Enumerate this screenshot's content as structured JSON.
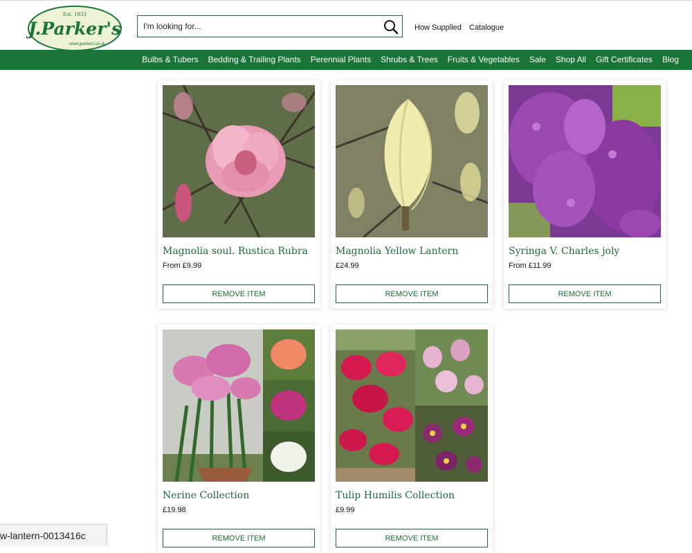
{
  "brand": {
    "logo_text": "J.Parker's",
    "logo_est": "Est. 1933",
    "logo_url": "www.jparkers.co.uk",
    "accent_color": "#1a7437"
  },
  "search": {
    "placeholder": "I'm looking for...",
    "value": ""
  },
  "header_links": [
    "How Supplied",
    "Catalogue"
  ],
  "nav_items": [
    "Bulbs & Tubers",
    "Bedding & Trailing Plants",
    "Perennial Plants",
    "Shrubs & Trees",
    "Fruits & Vegetables",
    "Sale",
    "Shop All",
    "Gift Certificates",
    "Blog"
  ],
  "products": [
    {
      "name": "Magnolia soul. Rustica Rubra",
      "price": "From £9.99",
      "button": "REMOVE ITEM"
    },
    {
      "name": "Magnolia Yellow Lantern",
      "price": "£24.99",
      "button": "REMOVE ITEM"
    },
    {
      "name": "Syringa V. Charles joly",
      "price": "From £11.99",
      "button": "REMOVE ITEM"
    },
    {
      "name": "Nerine Collection",
      "price": "£19.98",
      "button": "REMOVE ITEM"
    },
    {
      "name": "Tulip Humilis Collection",
      "price": "£9.99",
      "button": "REMOVE ITEM"
    }
  ],
  "status_bar": {
    "url_fragment": "w-lantern-0013416c"
  }
}
